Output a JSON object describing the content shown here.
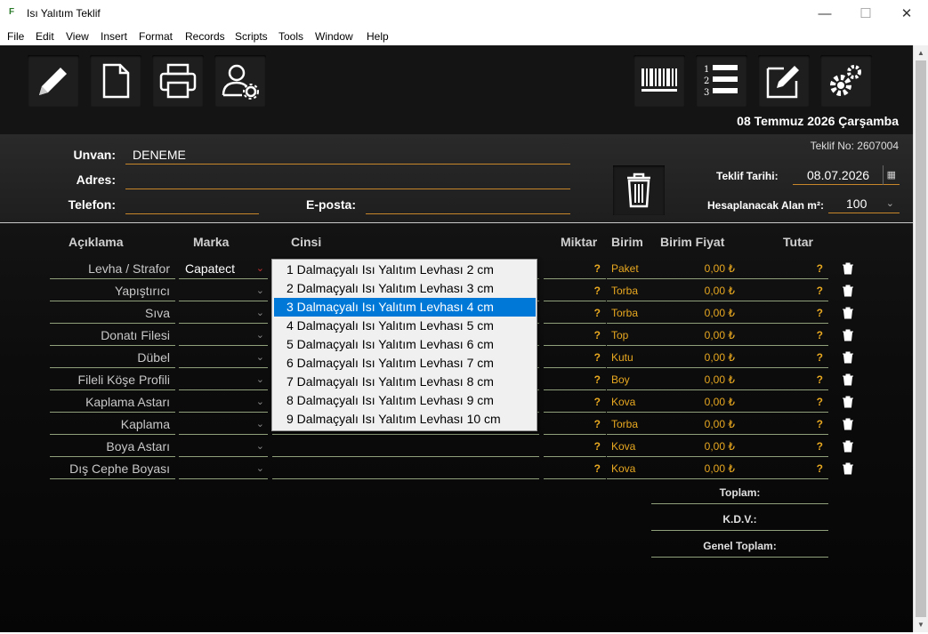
{
  "window": {
    "title": "Isı Yalıtım Teklif",
    "minimize": "—",
    "maximize": "☐",
    "close": "✕"
  },
  "menu": [
    "File",
    "Edit",
    "View",
    "Insert",
    "Format",
    "Records",
    "Scripts",
    "Tools",
    "Window",
    "Help"
  ],
  "toolbar": {
    "left_icons": [
      "pencil-icon",
      "new-document-icon",
      "print-icon",
      "user-settings-icon"
    ],
    "right_icons": [
      "barcode-icon",
      "numbered-list-icon",
      "edit-note-icon",
      "gears-icon"
    ]
  },
  "header": {
    "date": "08 Temmuz 2026 Çarşamba",
    "teklif_no": "Teklif No: 2607004"
  },
  "form": {
    "unvan_label": "Unvan:",
    "unvan_value": "DENEME",
    "adres_label": "Adres:",
    "adres_value": "",
    "telefon_label": "Telefon:",
    "telefon_value": "",
    "eposta_label": "E-posta:",
    "eposta_value": "",
    "teklif_tarihi_label": "Teklif Tarihi:",
    "teklif_tarihi_value": "08.07.2026",
    "alan_label": "Hesaplanacak Alan m²:",
    "alan_value": "100"
  },
  "columns": {
    "aciklama": "Açıklama",
    "marka": "Marka",
    "cinsi": "Cinsi",
    "miktar": "Miktar",
    "birim": "Birim",
    "birim_fiyat": "Birim Fiyat",
    "tutar": "Tutar"
  },
  "rows": [
    {
      "aciklama": "Levha / Strafor",
      "marka": "Capatect",
      "miktar": "?",
      "birim": "Paket",
      "birim_fiyat": "0,00 ₺",
      "tutar": "?"
    },
    {
      "aciklama": "Yapıştırıcı",
      "marka": "",
      "miktar": "?",
      "birim": "Torba",
      "birim_fiyat": "0,00 ₺",
      "tutar": "?"
    },
    {
      "aciklama": "Sıva",
      "marka": "",
      "miktar": "?",
      "birim": "Torba",
      "birim_fiyat": "0,00 ₺",
      "tutar": "?"
    },
    {
      "aciklama": "Donatı Filesi",
      "marka": "",
      "miktar": "?",
      "birim": "Top",
      "birim_fiyat": "0,00 ₺",
      "tutar": "?"
    },
    {
      "aciklama": "Dübel",
      "marka": "",
      "miktar": "?",
      "birim": "Kutu",
      "birim_fiyat": "0,00 ₺",
      "tutar": "?"
    },
    {
      "aciklama": "Fileli Köşe Profili",
      "marka": "",
      "miktar": "?",
      "birim": "Boy",
      "birim_fiyat": "0,00 ₺",
      "tutar": "?"
    },
    {
      "aciklama": "Kaplama Astarı",
      "marka": "",
      "miktar": "?",
      "birim": "Kova",
      "birim_fiyat": "0,00 ₺",
      "tutar": "?"
    },
    {
      "aciklama": "Kaplama",
      "marka": "",
      "miktar": "?",
      "birim": "Torba",
      "birim_fiyat": "0,00 ₺",
      "tutar": "?"
    },
    {
      "aciklama": "Boya Astarı",
      "marka": "",
      "miktar": "?",
      "birim": "Kova",
      "birim_fiyat": "0,00 ₺",
      "tutar": "?"
    },
    {
      "aciklama": "Dış Cephe Boyası",
      "marka": "",
      "miktar": "?",
      "birim": "Kova",
      "birim_fiyat": "0,00 ₺",
      "tutar": "?"
    }
  ],
  "totals": {
    "toplam": "Toplam:",
    "kdv": "K.D.V.:",
    "genel_toplam": "Genel Toplam:"
  },
  "dropdown": {
    "selected_index": 2,
    "items": [
      "1 Dalmaçyalı Isı Yalıtım Levhası 2 cm",
      "2 Dalmaçyalı Isı Yalıtım Levhası 3 cm",
      "3 Dalmaçyalı Isı Yalıtım Levhası 4 cm",
      "4 Dalmaçyalı Isı Yalıtım Levhası 5 cm",
      "5 Dalmaçyalı Isı Yalıtım Levhası 6 cm",
      "6 Dalmaçyalı Isı Yalıtım Levhası 7 cm",
      "7 Dalmaçyalı Isı Yalıtım Levhası 8 cm",
      "8 Dalmaçyalı Isı Yalıtım Levhası 9 cm",
      "9 Dalmaçyalı Isı Yalıtım Levhası 10 cm"
    ]
  }
}
